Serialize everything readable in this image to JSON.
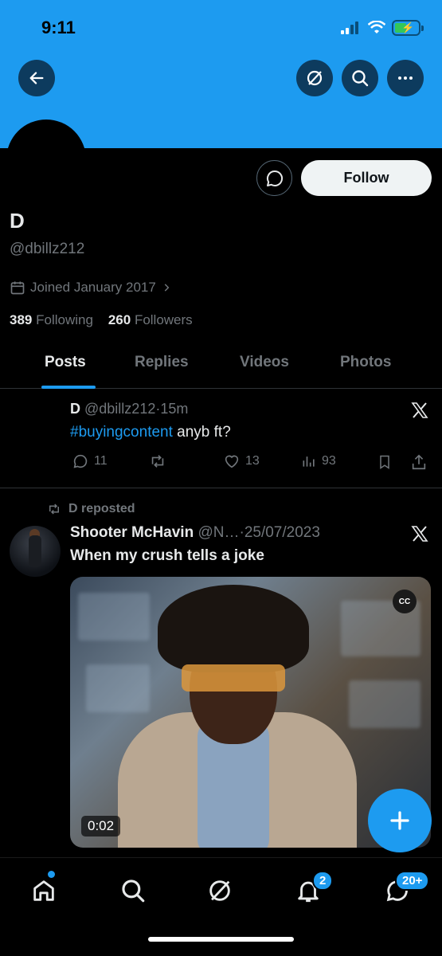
{
  "status_bar": {
    "time": "9:11"
  },
  "header": {
    "back_icon": "back-arrow-icon",
    "grok_icon": "grok-icon",
    "search_icon": "search-icon",
    "more_icon": "more-icon"
  },
  "profile": {
    "name": "D",
    "handle": "@dbillz212",
    "joined": "Joined January 2017",
    "following_count": "389",
    "following_label": "Following",
    "followers_count": "260",
    "followers_label": "Followers",
    "follow_label": "Follow"
  },
  "tabs": [
    {
      "label": "Posts"
    },
    {
      "label": "Replies"
    },
    {
      "label": "Videos"
    },
    {
      "label": "Photos"
    }
  ],
  "tweet1": {
    "author": "D",
    "handle": "@dbillz212",
    "sep": "·",
    "time": "15m",
    "hashtag": "#buyingcontent",
    "text": " anyb ft?",
    "replies": "11",
    "likes": "13",
    "views": "93"
  },
  "tweet2": {
    "repost_label": "D reposted",
    "author": "Shooter McHavin",
    "handle": "@N…",
    "sep": "·",
    "date": "25/07/2023",
    "text": "When my crush tells a joke",
    "cc_label": "CC",
    "duration": "0:02"
  },
  "bottom_nav": {
    "notifications_badge": "2",
    "messages_badge": "20+"
  },
  "colors": {
    "accent": "#1d9bf0",
    "banner": "#1d9bf0"
  }
}
